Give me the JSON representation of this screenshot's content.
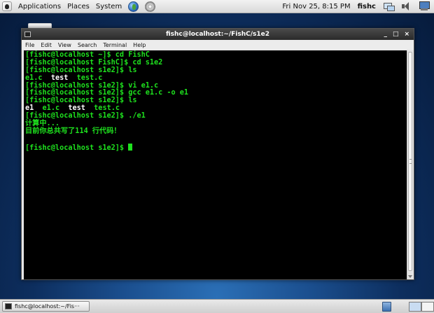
{
  "top_panel": {
    "menus": [
      "Applications",
      "Places",
      "System"
    ],
    "clock": "Fri Nov 25,  8:15 PM",
    "user": "fishc"
  },
  "window": {
    "title": "fishc@localhost:~/FishC/s1e2",
    "controls": {
      "minimize": "_",
      "maximize": "□",
      "close": "×"
    },
    "menu": [
      "File",
      "Edit",
      "View",
      "Search",
      "Terminal",
      "Help"
    ]
  },
  "terminal": {
    "lines": [
      "[fishc@localhost ~]$ cd FishC",
      "[fishc@localhost FishC]$ cd s1e2",
      "[fishc@localhost s1e2]$ ls",
      {
        "parts": [
          "e1.c  ",
          "test",
          "  test.c"
        ],
        "highlight": [
          1
        ]
      },
      "[fishc@localhost s1e2]$ vi e1.c",
      "[fishc@localhost s1e2]$ gcc e1.c -o e1",
      "[fishc@localhost s1e2]$ ls",
      {
        "parts": [
          "e1",
          "  e1.c  ",
          "test",
          "  test.c"
        ],
        "highlight": [
          0,
          2
        ]
      },
      "[fishc@localhost s1e2]$ ./e1",
      "计算中...",
      "目前你总共写了114 行代码！",
      "",
      "[fishc@localhost s1e2]$ "
    ]
  },
  "taskbar": {
    "task_label": "fishc@localhost:~/Fis···"
  },
  "colors": {
    "terminal_text": "#1ee21e",
    "terminal_bg": "#000000",
    "highlight_text": "#ffffff"
  }
}
